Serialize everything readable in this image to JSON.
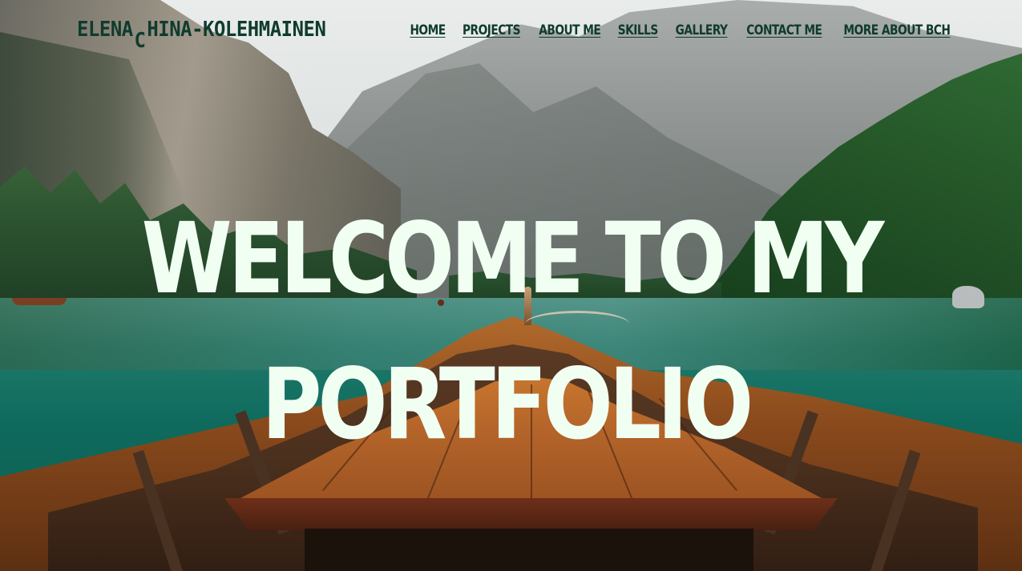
{
  "header": {
    "logo": {
      "first": "ELENA",
      "initial": "C",
      "rest": "HINA-KOLEHMAINEN"
    },
    "nav": [
      {
        "label": "HOME"
      },
      {
        "label": "PROJECTS"
      },
      {
        "label": "ABOUT ME"
      },
      {
        "label": "SKILLS"
      },
      {
        "label": "GALLERY"
      },
      {
        "label": "CONTACT ME"
      },
      {
        "label": "MORE ABOUT BCH"
      }
    ]
  },
  "hero": {
    "line1": "WELCOME TO MY",
    "line2": "PORTFOLIO"
  },
  "colors": {
    "logo_and_nav": "#0f3b2e",
    "hero_text": "#f1fff3"
  }
}
